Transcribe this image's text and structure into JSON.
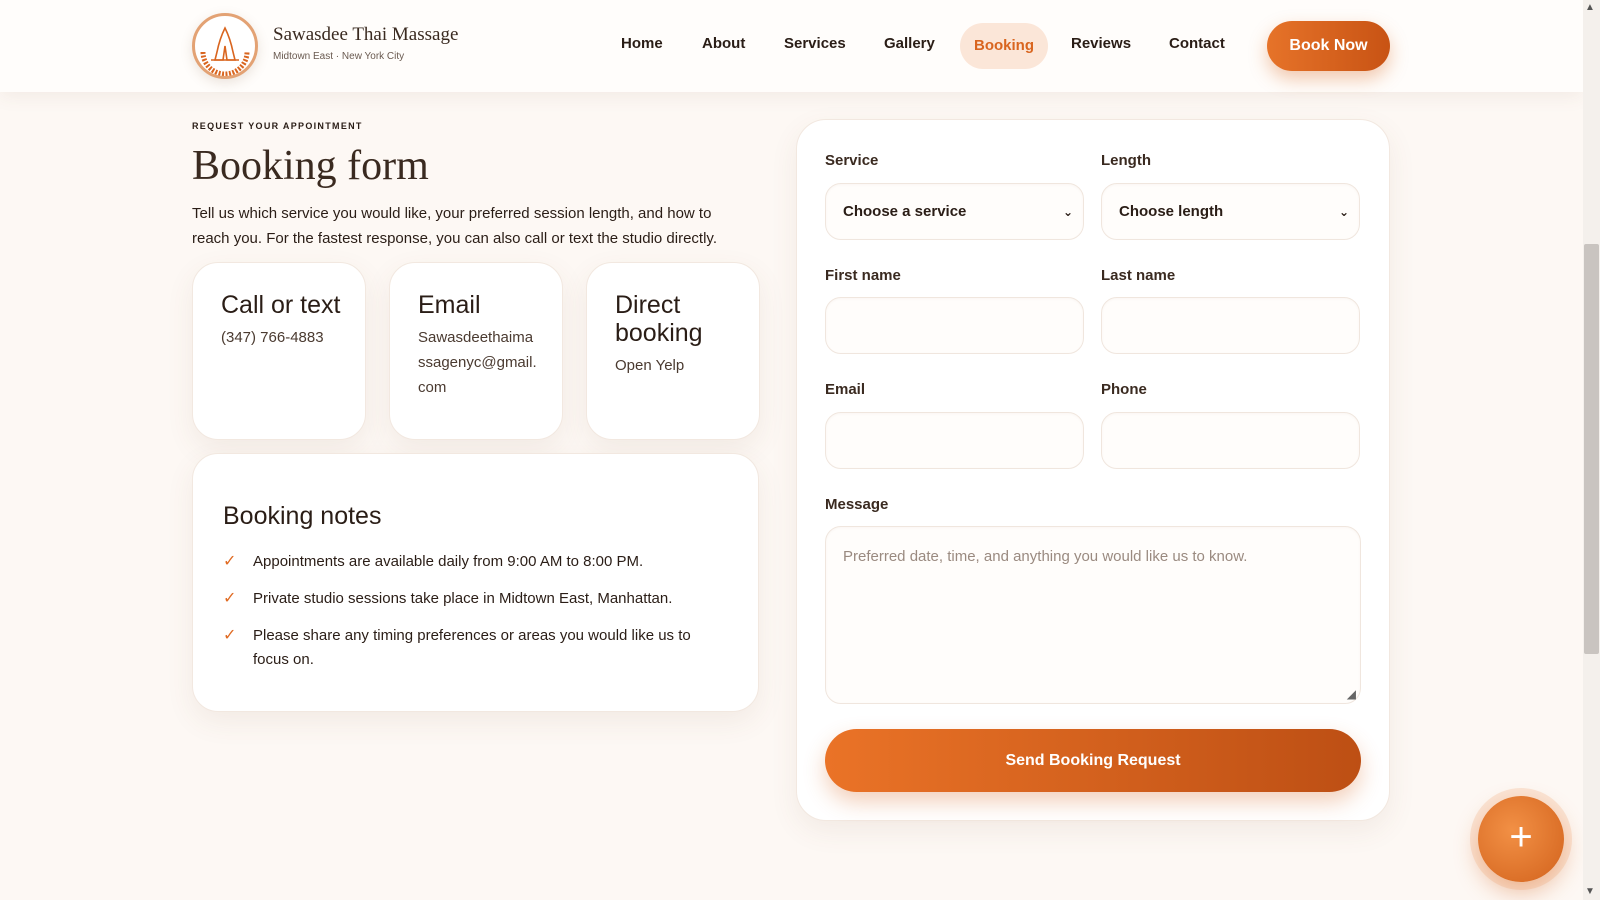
{
  "brand": {
    "name": "Sawasdee Thai Massage",
    "tagline": "Midtown East · New York City",
    "logo_icon": "praying-hands-icon",
    "logo_ring_text": "SAWASDEE THAI MASSAGE"
  },
  "nav": {
    "items": [
      {
        "label": "Home",
        "active": false
      },
      {
        "label": "About",
        "active": false
      },
      {
        "label": "Services",
        "active": false
      },
      {
        "label": "Gallery",
        "active": false
      },
      {
        "label": "Booking",
        "active": true
      },
      {
        "label": "Reviews",
        "active": false
      },
      {
        "label": "Contact",
        "active": false
      }
    ],
    "cta_label": "Book Now"
  },
  "intro": {
    "eyebrow": "REQUEST YOUR APPOINTMENT",
    "title": "Booking form",
    "text": "Tell us which service you would like, your preferred session length, and how to reach you. For the fastest response, you can also call or text the studio directly."
  },
  "contact_cards": [
    {
      "title": "Call or text",
      "value": "(347) 766-4883"
    },
    {
      "title": "Email",
      "value": "Sawasdeethaimassagenyc@gmail.com"
    },
    {
      "title": "Direct booking",
      "value": "Open Yelp"
    }
  ],
  "notes": {
    "title": "Booking notes",
    "items": [
      "Appointments are available daily from 9:00 AM to 8:00 PM.",
      "Private studio sessions take place in Midtown East, Manhattan.",
      "Please share any timing preferences or areas you would like us to focus on."
    ]
  },
  "form": {
    "service_label": "Service",
    "service_value": "Choose a service",
    "length_label": "Length",
    "length_value": "Choose length",
    "first_name_label": "First name",
    "first_name_value": "",
    "last_name_label": "Last name",
    "last_name_value": "",
    "email_label": "Email",
    "email_value": "",
    "phone_label": "Phone",
    "phone_value": "",
    "message_label": "Message",
    "message_placeholder": "Preferred date, time, and anything you would like us to know.",
    "submit_label": "Send Booking Request"
  },
  "colors": {
    "accent": "#e06b23",
    "accent_dark": "#bd4f14",
    "background": "#fdf8f4",
    "active_nav_bg": "#fbe6d8"
  },
  "icons": {
    "check": "check-icon",
    "select_chevron": "chevron-down-icon",
    "fab": "plus-icon"
  }
}
